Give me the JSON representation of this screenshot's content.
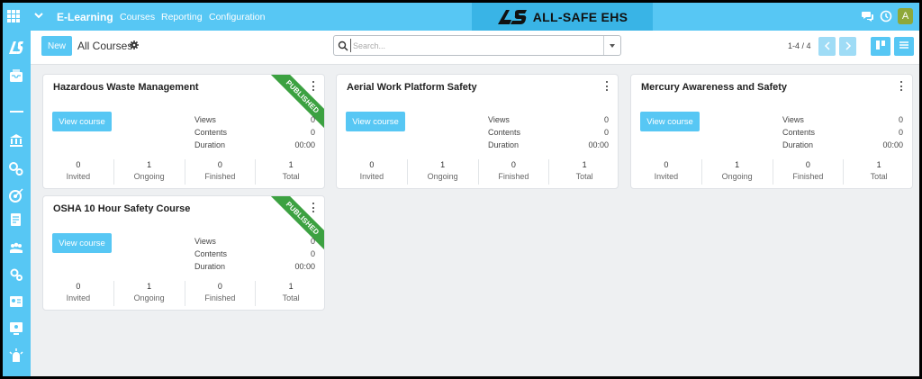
{
  "topbar": {
    "app_name": "E-Learning",
    "nav": [
      "Courses",
      "Reporting",
      "Configuration"
    ],
    "brand": "ALL-SAFE EHS",
    "user_initial": "A"
  },
  "control_panel": {
    "new_label": "New",
    "title": "All Courses",
    "search_placeholder": "Search...",
    "pager": "1-4 / 4"
  },
  "courses": [
    {
      "title": "Hazardous Waste Management",
      "published": true,
      "ribbon": "PUBLISHED",
      "button": "View course",
      "stats": [
        {
          "label": "Views",
          "value": "0"
        },
        {
          "label": "Contents",
          "value": "0"
        },
        {
          "label": "Duration",
          "value": "00:00"
        }
      ],
      "metrics": [
        {
          "label": "Invited",
          "value": "0"
        },
        {
          "label": "Ongoing",
          "value": "1"
        },
        {
          "label": "Finished",
          "value": "0"
        },
        {
          "label": "Total",
          "value": "1"
        }
      ]
    },
    {
      "title": "Aerial Work Platform Safety",
      "published": false,
      "button": "View course",
      "stats": [
        {
          "label": "Views",
          "value": "0"
        },
        {
          "label": "Contents",
          "value": "0"
        },
        {
          "label": "Duration",
          "value": "00:00"
        }
      ],
      "metrics": [
        {
          "label": "Invited",
          "value": "0"
        },
        {
          "label": "Ongoing",
          "value": "1"
        },
        {
          "label": "Finished",
          "value": "0"
        },
        {
          "label": "Total",
          "value": "1"
        }
      ]
    },
    {
      "title": "Mercury Awareness and Safety",
      "published": false,
      "button": "View course",
      "stats": [
        {
          "label": "Views",
          "value": "0"
        },
        {
          "label": "Contents",
          "value": "0"
        },
        {
          "label": "Duration",
          "value": "00:00"
        }
      ],
      "metrics": [
        {
          "label": "Invited",
          "value": "0"
        },
        {
          "label": "Ongoing",
          "value": "1"
        },
        {
          "label": "Finished",
          "value": "0"
        },
        {
          "label": "Total",
          "value": "1"
        }
      ]
    },
    {
      "title": "OSHA 10 Hour Safety Course",
      "published": true,
      "ribbon": "PUBLISHED",
      "button": "View course",
      "stats": [
        {
          "label": "Views",
          "value": "0"
        },
        {
          "label": "Contents",
          "value": "0"
        },
        {
          "label": "Duration",
          "value": "00:00"
        }
      ],
      "metrics": [
        {
          "label": "Invited",
          "value": "0"
        },
        {
          "label": "Ongoing",
          "value": "1"
        },
        {
          "label": "Finished",
          "value": "0"
        },
        {
          "label": "Total",
          "value": "1"
        }
      ]
    }
  ],
  "colors": {
    "accent": "#57c7f4",
    "brand_bg": "#39b4e6",
    "ribbon": "#3ca141",
    "avatar": "#8ea83a"
  },
  "icons": [
    "apps-grid-icon",
    "chevron-down-icon",
    "chat-icon",
    "clock-icon",
    "settings-gear-icon",
    "search-icon",
    "kanban-view-icon",
    "list-view-icon",
    "chevron-left-icon",
    "chevron-right-icon",
    "kebab-menu-icon"
  ]
}
